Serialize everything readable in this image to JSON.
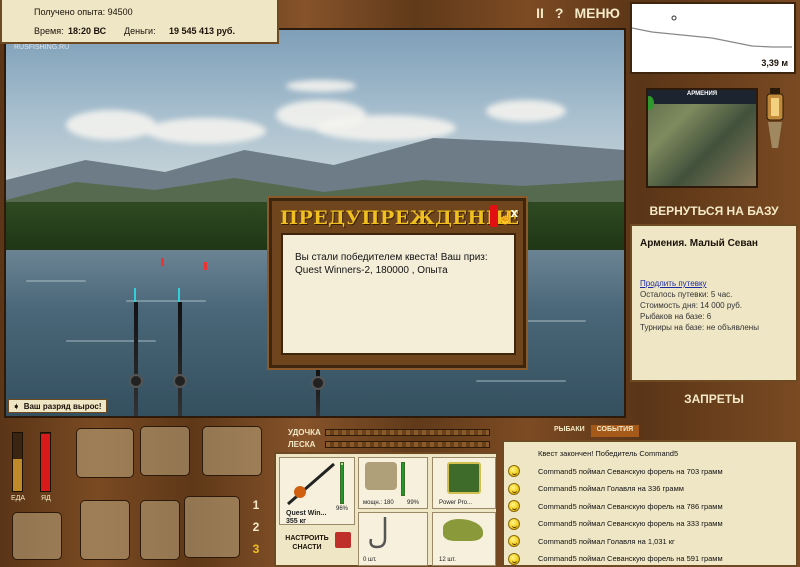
{
  "info": {
    "exp_label": "Получено опыта:",
    "exp_value": "94500",
    "time_label": "Время:",
    "time_value": "18:20 ВС",
    "money_label": "Деньги:",
    "money_value": "19 545 413 руб."
  },
  "topbar": {
    "pause": "II",
    "help": "?",
    "menu": "МЕНЮ"
  },
  "scene": {
    "watermark": "RUSFISHING.RU",
    "rank_message": "Ваш разряд вырос!"
  },
  "dialog": {
    "title": "ПРЕДУПРЕЖДЕНИЕ",
    "close": "x",
    "message": "Вы стали победителем квеста! Ваш приз: Quest Winners-2, 180000 , Опыта"
  },
  "right": {
    "depth": "3,39 м",
    "map_title": "АРМЕНИЯ",
    "back_to_base": "ВЕРНУТЬСЯ НА БАЗУ",
    "location": "Армения. Малый Севан",
    "extend_pass": "Продлить путевку",
    "info_lines": [
      "Осталось путевки: 5 час.",
      "Стоимость дня: 14 000 руб.",
      "Рыбаков на базе: 6",
      "Турниры на базе: не объявлены"
    ],
    "bans": "ЗАПРЕТЫ"
  },
  "bottom": {
    "food_label": "ЕДА",
    "poison_label": "ЯД",
    "food_level": 0.55,
    "poison_level": 0.98,
    "levels": [
      "1",
      "2",
      "3"
    ],
    "active_level": "3",
    "rod_label": "УДОЧКА",
    "line_label": "ЛЕСКА",
    "tabs": [
      "РЫБАКИ",
      "СОБЫТИЯ"
    ],
    "gear": {
      "rod_name": "Quest Win...",
      "rod_weight": "355 кг",
      "rod_percent": "96%",
      "rod_durability": 0.96,
      "reel_caption": "мощн.: 180",
      "reel_percent": "99%",
      "reel_durability": 0.99,
      "line_caption": "Power Pro...",
      "setup_button": "НАСТРОИТЬ СНАСТИ",
      "hook_count": "0 шт.",
      "bait_count": "12 шт."
    }
  },
  "events": [
    {
      "text": "Квест закончен! Победитель Command5",
      "icon": "none"
    },
    {
      "text": "Command5 поймал Севанскую форель на 703 грамм",
      "icon": "smiley-icon"
    },
    {
      "text": "Command5 поймал Голавля на 336 грамм",
      "icon": "smiley-icon"
    },
    {
      "text": "Command5 поймал Севанскую форель на 786 грамм",
      "icon": "smiley-icon"
    },
    {
      "text": "Command5 поймал Севанскую форель на 333 грамм",
      "icon": "smiley-icon"
    },
    {
      "text": "Command5 поймал Голавля на 1,031 кг",
      "icon": "smiley-icon"
    },
    {
      "text": "Command5 поймал Севанскую форель на 591 грамм",
      "icon": "smiley-icon"
    }
  ],
  "colors": {
    "panel_bg": "#efe6c6",
    "wood": "#6a4018",
    "title_gold": "#f0c020",
    "alert_red": "#e21010",
    "link_blue": "#1a2aa5"
  }
}
